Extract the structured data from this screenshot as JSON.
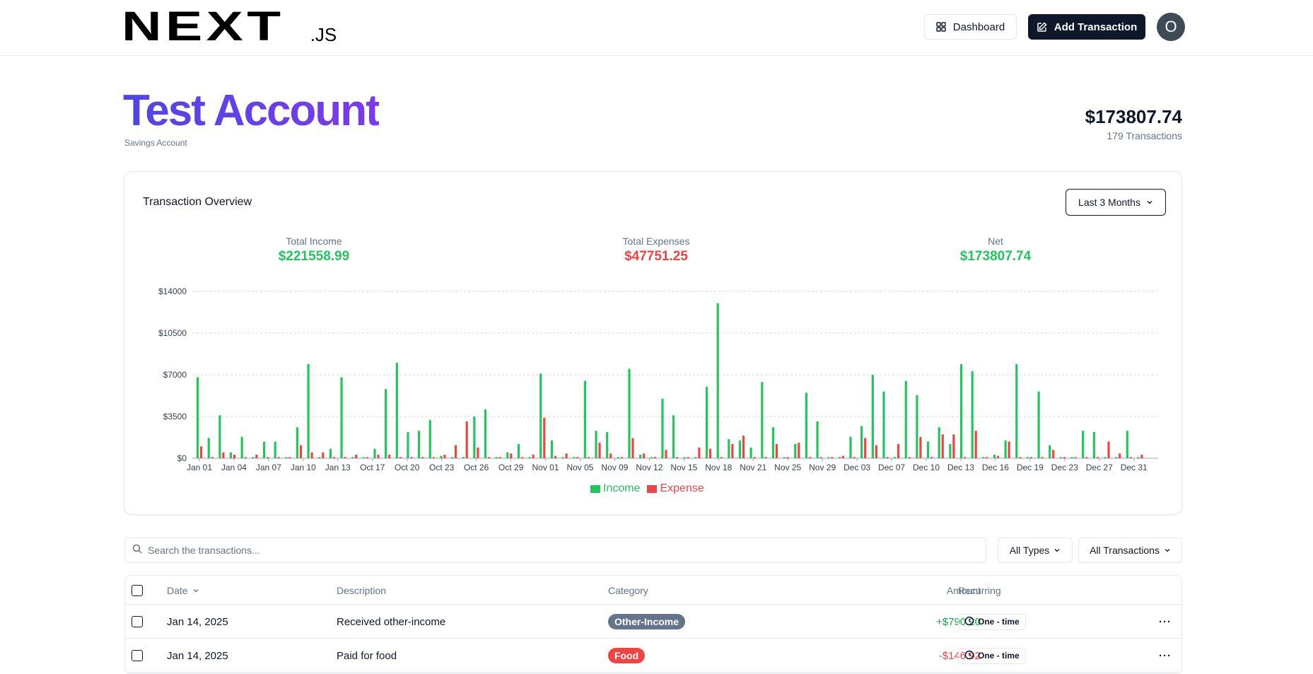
{
  "header": {
    "logo_main": "NEXT",
    "logo_suffix": ".JS",
    "dashboard_label": "Dashboard",
    "add_transaction_label": "Add Transaction",
    "avatar_initial": "O"
  },
  "account": {
    "name": "Test Account",
    "type": "Savings Account",
    "balance": "$173807.74",
    "transaction_count": "179 Transactions"
  },
  "overview": {
    "title": "Transaction Overview",
    "range_label": "Last 3 Months",
    "stats": [
      {
        "label": "Total Income",
        "value": "$221558.99",
        "color": "#22c55e"
      },
      {
        "label": "Total Expenses",
        "value": "$47751.25",
        "color": "#ef4444"
      },
      {
        "label": "Net",
        "value": "$173807.74",
        "color": "#22c55e"
      }
    ]
  },
  "chart_data": {
    "type": "bar",
    "ylim": [
      0,
      14000
    ],
    "yticks": [
      "$0",
      "$3500",
      "$7000",
      "$10500",
      "$14000"
    ],
    "grid": true,
    "legend_position": "bottom",
    "x_tick_labels": [
      "Jan 01",
      "Jan 04",
      "Jan 07",
      "Jan 10",
      "Jan 13",
      "Oct 17",
      "Oct 20",
      "Oct 23",
      "Oct 26",
      "Oct 29",
      "Nov 01",
      "Nov 05",
      "Nov 09",
      "Nov 12",
      "Nov 15",
      "Nov 18",
      "Nov 21",
      "Nov 25",
      "Nov 29",
      "Dec 03",
      "Dec 07",
      "Dec 10",
      "Dec 13",
      "Dec 16",
      "Dec 19",
      "Dec 23",
      "Dec 27",
      "Dec 31"
    ],
    "series": [
      {
        "name": "Income",
        "color": "#22c55e",
        "values": [
          6800,
          1700,
          3600,
          500,
          1800,
          100,
          1400,
          1400,
          100,
          2600,
          7900,
          100,
          800,
          6800,
          100,
          100,
          800,
          5800,
          8000,
          2200,
          2300,
          3200,
          200,
          100,
          100,
          3500,
          4100,
          100,
          500,
          1200,
          100,
          7100,
          1500,
          100,
          100,
          6500,
          2300,
          2200,
          100,
          7500,
          300,
          100,
          5000,
          3600,
          100,
          100,
          6000,
          13000,
          1600,
          1500,
          900,
          6400,
          2600,
          100,
          1200,
          5500,
          3100,
          100,
          100,
          1800,
          2700,
          7000,
          5600,
          100,
          6500,
          5300,
          1400,
          2600,
          1200,
          7900,
          7300,
          100,
          300,
          1500,
          7900,
          100,
          5600,
          1100,
          100,
          100,
          2300,
          2200,
          100,
          100,
          2300,
          100
        ]
      },
      {
        "name": "Expense",
        "color": "#ef4444",
        "values": [
          1000,
          100,
          500,
          300,
          100,
          300,
          100,
          100,
          100,
          1100,
          500,
          500,
          100,
          100,
          300,
          100,
          300,
          300,
          100,
          100,
          100,
          100,
          300,
          1100,
          3100,
          900,
          100,
          100,
          400,
          100,
          300,
          3400,
          200,
          400,
          100,
          100,
          1300,
          400,
          100,
          1700,
          400,
          100,
          700,
          100,
          100,
          900,
          800,
          100,
          1200,
          1900,
          100,
          100,
          1200,
          100,
          1300,
          100,
          100,
          100,
          200,
          100,
          1700,
          1100,
          100,
          1200,
          100,
          1800,
          100,
          2000,
          2000,
          100,
          2300,
          100,
          200,
          1400,
          100,
          100,
          100,
          700,
          100,
          100,
          100,
          100,
          1400,
          400,
          100,
          300
        ]
      }
    ]
  },
  "filters": {
    "search_placeholder": "Search the transactions...",
    "type_select": "All Types",
    "recurring_select": "All Transactions"
  },
  "table": {
    "headers": {
      "date": "Date",
      "description": "Description",
      "category": "Category",
      "amount": "Amount",
      "recurring": "Recurring"
    },
    "rows": [
      {
        "date": "Jan 14, 2025",
        "description": "Received other-income",
        "category": "Other-Income",
        "category_color": "#64748b",
        "amount": "+$790.20",
        "amount_color": "#16a34a",
        "recurring": "One - time"
      },
      {
        "date": "Jan 14, 2025",
        "description": "Paid for food",
        "category": "Food",
        "category_color": "#ef4444",
        "amount": "-$146.92",
        "amount_color": "#ef4444",
        "recurring": "One - time"
      }
    ]
  }
}
